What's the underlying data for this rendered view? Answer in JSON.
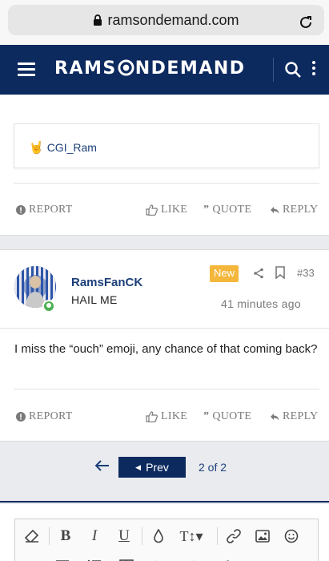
{
  "browser": {
    "url": "ramsondemand.com"
  },
  "header": {
    "logo_text": "RAMSONDEMAND",
    "logo_pre": "RAMS",
    "logo_post": "NDEMAND"
  },
  "post_prev": {
    "quote_user": "CGI_Ram",
    "actions": {
      "report": "REPORT",
      "like": "LIKE",
      "quote": "QUOTE",
      "reply": "REPLY"
    }
  },
  "post": {
    "username": "RamsFanCK",
    "user_title": "HAIL ME",
    "badge": "New",
    "post_number": "#33",
    "time": "41 minutes ago",
    "message": "I miss the “ouch” emoji, any chance of that coming back?",
    "actions": {
      "report": "REPORT",
      "like": "LIKE",
      "quote": "QUOTE",
      "reply": "REPLY"
    }
  },
  "pagination": {
    "prev_label": "Prev",
    "page_info": "2 of 2"
  },
  "editor": {
    "tools": [
      "eraser-icon",
      "bold-icon",
      "italic-icon",
      "underline-icon",
      "color-icon",
      "text-size-icon",
      "link-icon",
      "image-icon",
      "smiley-icon"
    ]
  },
  "colors": {
    "brand_navy": "#0d2a5f",
    "badge_new": "#f4b73b",
    "online": "#4caf50",
    "link_blue": "#1c3f7a"
  }
}
